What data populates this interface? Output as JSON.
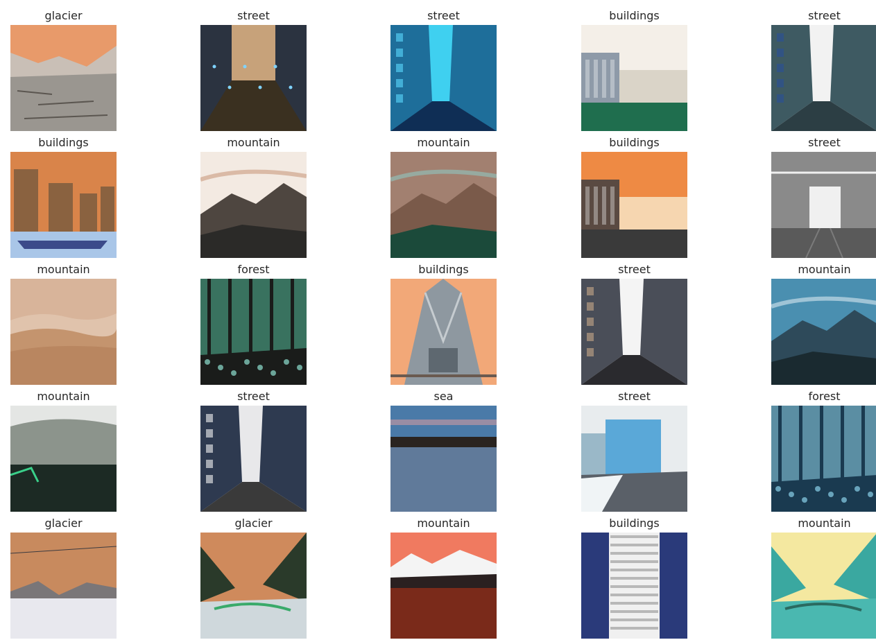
{
  "figure": {
    "rows": [
      [
        {
          "label": "glacier",
          "scene": "glacier",
          "sky": "#e89a6a",
          "mid": "#c9bfb6",
          "ground": "#9a9690",
          "accent": "#5b5650"
        },
        {
          "label": "street",
          "scene": "canal",
          "sky": "#c7a27a",
          "mid": "#2b3340",
          "ground": "#3a3020",
          "accent": "#7fd3ff"
        },
        {
          "label": "street",
          "scene": "street",
          "sky": "#3fd0f0",
          "mid": "#1e6e9a",
          "ground": "#0f2e55",
          "accent": "#5ad8ff"
        },
        {
          "label": "buildings",
          "scene": "buildings",
          "sky": "#f4efe8",
          "mid": "#8e9aa8",
          "ground": "#1f6e4e",
          "accent": "#dad4c8"
        },
        {
          "label": "street",
          "scene": "street",
          "sky": "#f2f2f2",
          "mid": "#3e5a62",
          "ground": "#2c3e44",
          "accent": "#2a4f9a"
        }
      ],
      [
        {
          "label": "buildings",
          "scene": "towers",
          "sky": "#d9844a",
          "mid": "#8a6240",
          "ground": "#a9c6e8",
          "accent": "#3b4a8a"
        },
        {
          "label": "mountain",
          "scene": "mountain",
          "sky": "#f3eae2",
          "mid": "#4e4640",
          "ground": "#2b2a28",
          "accent": "#c99a7e"
        },
        {
          "label": "mountain",
          "scene": "mountain",
          "sky": "#a28070",
          "mid": "#7a5a4a",
          "ground": "#1b4a3a",
          "accent": "#8fc7c0"
        },
        {
          "label": "buildings",
          "scene": "buildings",
          "sky": "#ee8a44",
          "mid": "#5a4a42",
          "ground": "#3a3a3a",
          "accent": "#f6d6b0"
        },
        {
          "label": "street",
          "scene": "tram",
          "sky": "#dddddd",
          "mid": "#8a8a8a",
          "ground": "#3a3a3a",
          "accent": "#f0f0f0"
        }
      ],
      [
        {
          "label": "mountain",
          "scene": "haze",
          "sky": "#d8b49a",
          "mid": "#c4946e",
          "ground": "#b98660",
          "accent": "#e0c3ac"
        },
        {
          "label": "forest",
          "scene": "forest",
          "sky": "#6c8a6c",
          "mid": "#2d6b5c",
          "ground": "#1a1c1a",
          "accent": "#8fe0d0"
        },
        {
          "label": "buildings",
          "scene": "cathedral",
          "sky": "#f2a878",
          "mid": "#8e98a0",
          "ground": "#5e6870",
          "accent": "#c6ccd0"
        },
        {
          "label": "street",
          "scene": "street",
          "sky": "#f4f4f4",
          "mid": "#4a4e58",
          "ground": "#2a2a2e",
          "accent": "#c8a888"
        },
        {
          "label": "mountain",
          "scene": "mountain",
          "sky": "#4a8fb0",
          "mid": "#2e4a5a",
          "ground": "#1a2a30",
          "accent": "#d8e8f0"
        }
      ],
      [
        {
          "label": "mountain",
          "scene": "fog",
          "sky": "#e4e6e4",
          "mid": "#8c948c",
          "ground": "#1c2a24",
          "accent": "#3ad08a"
        },
        {
          "label": "street",
          "scene": "street",
          "sky": "#e8e8ea",
          "mid": "#2e3a50",
          "ground": "#3a3a3a",
          "accent": "#f4f4f4"
        },
        {
          "label": "sea",
          "scene": "sea",
          "sky": "#4a7aa8",
          "mid": "#2a2420",
          "ground": "#607a9a",
          "accent": "#e8a0a0"
        },
        {
          "label": "street",
          "scene": "snowtown",
          "sky": "#e8ecee",
          "mid": "#5aa8d8",
          "ground": "#5a6068",
          "accent": "#f0f4f6"
        },
        {
          "label": "forest",
          "scene": "forest",
          "sky": "#e0a070",
          "mid": "#3a8ab0",
          "ground": "#1a3a50",
          "accent": "#8ad0e8"
        }
      ],
      [
        {
          "label": "glacier",
          "scene": "snow",
          "sky": "#c88a5e",
          "mid": "#7a7678",
          "ground": "#e8e8ee",
          "accent": "#3a3a40"
        },
        {
          "label": "glacier",
          "scene": "valley",
          "sky": "#cf8a5c",
          "mid": "#2a3a2a",
          "ground": "#cfd8dc",
          "accent": "#3aaa6a"
        },
        {
          "label": "mountain",
          "scene": "lake",
          "sky": "#f07a60",
          "mid": "#2a2020",
          "ground": "#7a2a1a",
          "accent": "#f4f4f4"
        },
        {
          "label": "buildings",
          "scene": "facade",
          "sky": "#d8dadc",
          "mid": "#2a3a7a",
          "ground": "#4a4a4a",
          "accent": "#f0f0f0"
        },
        {
          "label": "mountain",
          "scene": "valley",
          "sky": "#f4e8a0",
          "mid": "#3aa8a0",
          "ground": "#4ab8b0",
          "accent": "#2a6a60"
        }
      ]
    ]
  }
}
